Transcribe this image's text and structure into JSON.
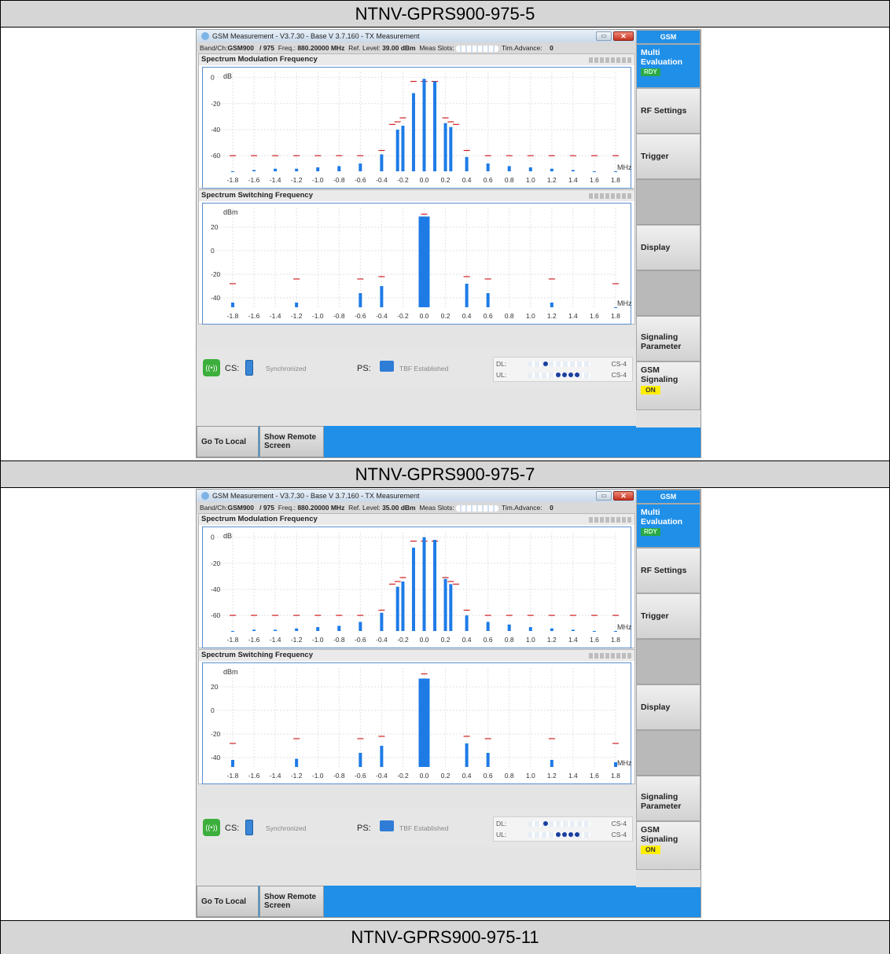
{
  "rows": [
    {
      "label": "NTNV-GPRS900-975-5"
    },
    {
      "label": "NTNV-GPRS900-975-7"
    },
    {
      "label": "NTNV-GPRS900-975-11"
    }
  ],
  "screens": [
    {
      "window_title": "GSM Measurement  - V3.7.30 - Base V 3.7.160 - TX Measurement",
      "info": {
        "band_label": "Band/Ch:",
        "band": "GSM900",
        "ch": "/  975",
        "freq_label": "Freq.:",
        "freq": "880.20000 MHz",
        "ref_label": "Ref. Level:",
        "ref": "39.00 dBm",
        "slots_label": "Meas Slots:",
        "ta_label": "Tim.Advance:",
        "ta": "0"
      }
    },
    {
      "window_title": "GSM Measurement  - V3.7.30 - Base V 3.7.160 - TX Measurement",
      "info": {
        "band_label": "Band/Ch:",
        "band": "GSM900",
        "ch": "/  975",
        "freq_label": "Freq.:",
        "freq": "880.20000 MHz",
        "ref_label": "Ref. Level:",
        "ref": "35.00 dBm",
        "slots_label": "Meas Slots:",
        "ta_label": "Tim.Advance:",
        "ta": "0"
      }
    }
  ],
  "common": {
    "mod_title": "Spectrum Modulation Frequency",
    "sw_title": "Spectrum Switching Frequency",
    "mod_unit": "dB",
    "sw_unit": "dBm",
    "x_unit": "MHz",
    "cs_label": "CS:",
    "cs_status": "Synchronized",
    "ps_label": "PS:",
    "ps_status": "TBF Established",
    "dl_label": "DL:",
    "ul_label": "UL:",
    "dl_cs": "CS-4",
    "ul_cs": "CS-4",
    "go_local": "Go To Local",
    "show_remote": "Show Remote Screen",
    "softkeys": {
      "gsm": "GSM",
      "multi_eval": "Multi Evaluation",
      "rdy": "RDY",
      "rf_settings": "RF Settings",
      "trigger": "Trigger",
      "display": "Display",
      "signaling_param": "Signaling Parameter",
      "gsm_signaling": "GSM Signaling",
      "on": "ON"
    },
    "colors": {
      "bar": "#1e7be6",
      "limit": "#d02020",
      "accent": "#1f8fe8",
      "rdy": "#2aa84a",
      "on": "#ffee00"
    }
  },
  "chart_data": [
    {
      "type": "bar",
      "title": "Spectrum Modulation Frequency",
      "ylabel": "dB",
      "xlabel": "MHz",
      "x_ticks": [
        "-1.8",
        "-1.6",
        "-1.4",
        "-1.2",
        "-1.0",
        "-0.8",
        "-0.6",
        "-0.4",
        "-0.2",
        "0.0",
        "0.2",
        "0.4",
        "0.6",
        "0.8",
        "1.0",
        "1.2",
        "1.4",
        "1.6",
        "1.8"
      ],
      "y_ticks": [
        0,
        -20,
        -40,
        -60
      ],
      "ylim": [
        -72,
        4
      ],
      "x": [
        -1.8,
        -1.6,
        -1.4,
        -1.2,
        -1.0,
        -0.8,
        -0.6,
        -0.4,
        -0.25,
        -0.2,
        -0.1,
        0.0,
        0.1,
        0.2,
        0.25,
        0.4,
        0.6,
        0.8,
        1.0,
        1.2,
        1.4,
        1.6,
        1.8
      ],
      "values": [
        -72,
        -71,
        -70,
        -70,
        -69,
        -68,
        -66,
        -59,
        -40,
        -37,
        -12,
        -1,
        -3,
        -35,
        -38,
        -61,
        -66,
        -68,
        -69,
        -70,
        -71,
        -72,
        -72
      ],
      "limit_x": [
        -1.8,
        -1.6,
        -1.4,
        -1.2,
        -1.0,
        -0.8,
        -0.6,
        -0.4,
        -0.3,
        -0.25,
        -0.2,
        -0.1,
        0.0,
        0.1,
        0.2,
        0.25,
        0.3,
        0.4,
        0.6,
        0.8,
        1.0,
        1.2,
        1.4,
        1.6,
        1.8
      ],
      "limit_y": [
        -60,
        -60,
        -60,
        -60,
        -60,
        -60,
        -60,
        -56,
        -36,
        -34,
        -31,
        -3,
        -3,
        -3,
        -31,
        -34,
        -36,
        -56,
        -60,
        -60,
        -60,
        -60,
        -60,
        -60,
        -60
      ]
    },
    {
      "type": "bar",
      "title": "Spectrum Switching Frequency",
      "ylabel": "dBm",
      "xlabel": "MHz",
      "x_ticks": [
        "-1.8",
        "-1.6",
        "-1.4",
        "-1.2",
        "-1.0",
        "-0.8",
        "-0.6",
        "-0.4",
        "-0.2",
        "0.0",
        "0.2",
        "0.4",
        "0.6",
        "0.8",
        "1.0",
        "1.2",
        "1.4",
        "1.6",
        "1.8"
      ],
      "y_ticks": [
        20,
        0,
        -20,
        -40
      ],
      "ylim": [
        -48,
        36
      ],
      "x": [
        -1.8,
        -1.2,
        -0.6,
        -0.4,
        0.0,
        0.4,
        0.6,
        1.2,
        1.8
      ],
      "values": [
        -44,
        -44,
        -36,
        -30,
        29,
        -28,
        -36,
        -44,
        -48
      ],
      "limit_x": [
        -1.8,
        -1.2,
        -0.6,
        -0.4,
        0.0,
        0.4,
        0.6,
        1.2,
        1.8
      ],
      "limit_y": [
        -28,
        -24,
        -24,
        -22,
        31,
        -22,
        -24,
        -24,
        -28
      ]
    },
    {
      "type": "bar",
      "title": "Spectrum Modulation Frequency",
      "ylabel": "dB",
      "xlabel": "MHz",
      "x_ticks": [
        "-1.8",
        "-1.6",
        "-1.4",
        "-1.2",
        "-1.0",
        "-0.8",
        "-0.6",
        "-0.4",
        "-0.2",
        "0.0",
        "0.2",
        "0.4",
        "0.6",
        "0.8",
        "1.0",
        "1.2",
        "1.4",
        "1.6",
        "1.8"
      ],
      "y_ticks": [
        0,
        -20,
        -40,
        -60
      ],
      "ylim": [
        -72,
        4
      ],
      "x": [
        -1.8,
        -1.6,
        -1.4,
        -1.2,
        -1.0,
        -0.8,
        -0.6,
        -0.4,
        -0.25,
        -0.2,
        -0.1,
        0.0,
        0.1,
        0.2,
        0.25,
        0.4,
        0.6,
        0.8,
        1.0,
        1.2,
        1.4,
        1.6,
        1.8
      ],
      "values": [
        -72,
        -71,
        -71,
        -70,
        -69,
        -68,
        -65,
        -58,
        -38,
        -34,
        -8,
        0,
        -2,
        -32,
        -36,
        -60,
        -65,
        -67,
        -69,
        -70,
        -71,
        -72,
        -72
      ],
      "limit_x": [
        -1.8,
        -1.6,
        -1.4,
        -1.2,
        -1.0,
        -0.8,
        -0.6,
        -0.4,
        -0.3,
        -0.25,
        -0.2,
        -0.1,
        0.0,
        0.1,
        0.2,
        0.25,
        0.3,
        0.4,
        0.6,
        0.8,
        1.0,
        1.2,
        1.4,
        1.6,
        1.8
      ],
      "limit_y": [
        -60,
        -60,
        -60,
        -60,
        -60,
        -60,
        -60,
        -56,
        -36,
        -34,
        -31,
        -3,
        -3,
        -3,
        -31,
        -34,
        -36,
        -56,
        -60,
        -60,
        -60,
        -60,
        -60,
        -60,
        -60
      ]
    },
    {
      "type": "bar",
      "title": "Spectrum Switching Frequency",
      "ylabel": "dBm",
      "xlabel": "MHz",
      "x_ticks": [
        "-1.8",
        "-1.6",
        "-1.4",
        "-1.2",
        "-1.0",
        "-0.8",
        "-0.6",
        "-0.4",
        "-0.2",
        "0.0",
        "0.2",
        "0.4",
        "0.6",
        "0.8",
        "1.0",
        "1.2",
        "1.4",
        "1.6",
        "1.8"
      ],
      "y_ticks": [
        20,
        0,
        -20,
        -40
      ],
      "ylim": [
        -48,
        36
      ],
      "x": [
        -1.8,
        -1.2,
        -0.6,
        -0.4,
        0.0,
        0.4,
        0.6,
        1.2,
        1.8
      ],
      "values": [
        -42,
        -41,
        -36,
        -30,
        27,
        -28,
        -36,
        -42,
        -44
      ],
      "limit_x": [
        -1.8,
        -1.2,
        -0.6,
        -0.4,
        0.0,
        0.4,
        0.6,
        1.2,
        1.8
      ],
      "limit_y": [
        -28,
        -24,
        -24,
        -22,
        31,
        -22,
        -24,
        -24,
        -28
      ]
    }
  ]
}
